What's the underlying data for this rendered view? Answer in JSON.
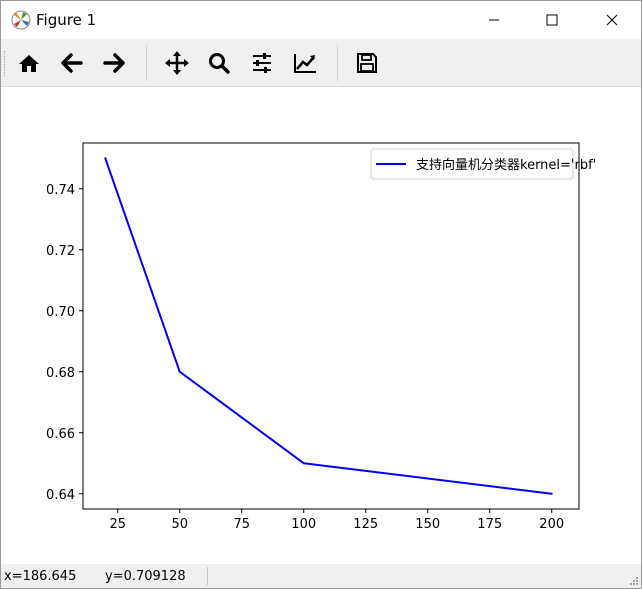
{
  "window": {
    "title": "Figure 1"
  },
  "toolbar": {
    "buttons": [
      {
        "icon": "home-icon",
        "action": "Home"
      },
      {
        "icon": "arrow-left-icon",
        "action": "Back"
      },
      {
        "icon": "arrow-right-icon",
        "action": "Forward"
      },
      {
        "icon": "move-arrows-icon",
        "action": "Pan"
      },
      {
        "icon": "magnifier-icon",
        "action": "Zoom"
      },
      {
        "icon": "sliders-icon",
        "action": "Subplots"
      },
      {
        "icon": "line-chart-icon",
        "action": "Customize"
      },
      {
        "icon": "floppy-disk-icon",
        "action": "Save"
      }
    ]
  },
  "statusbar": {
    "x": "x=186.645",
    "y": "y=0.709128"
  },
  "chart_data": {
    "type": "line",
    "title": "",
    "xlabel": "",
    "ylabel": "",
    "xlim": [
      11,
      211
    ],
    "ylim": [
      0.635,
      0.755
    ],
    "xticks": [
      25,
      50,
      75,
      100,
      125,
      150,
      175,
      200
    ],
    "yticks": [
      0.64,
      0.66,
      0.68,
      0.7,
      0.72,
      0.74
    ],
    "grid": false,
    "legend_position": "upper right",
    "series": [
      {
        "name": "支持向量机分类器kernel='rbf'",
        "color": "#0000ff",
        "x": [
          20,
          50,
          100,
          200
        ],
        "y": [
          0.75,
          0.68,
          0.65,
          0.64
        ]
      }
    ]
  }
}
